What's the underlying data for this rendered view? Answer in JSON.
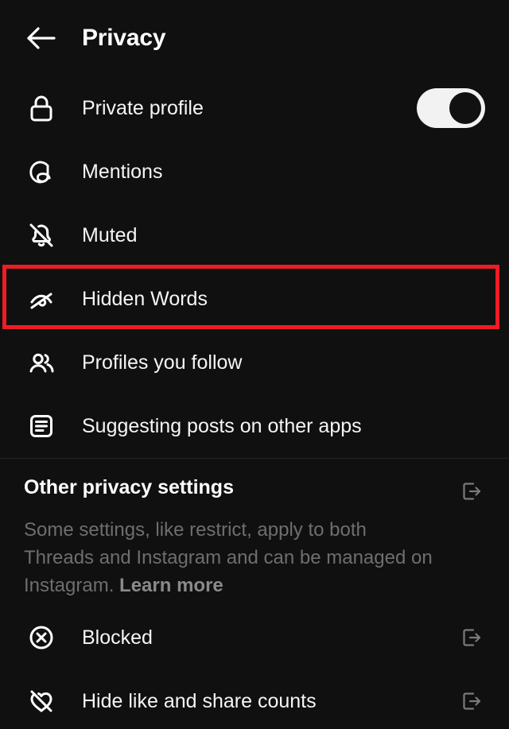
{
  "header": {
    "title": "Privacy",
    "back_icon": "arrow-left-icon"
  },
  "main_settings": [
    {
      "label": "Private profile",
      "icon": "lock-icon",
      "control": "toggle",
      "toggle_on": true
    },
    {
      "label": "Mentions",
      "icon": "threads-logo-icon",
      "control": "none"
    },
    {
      "label": "Muted",
      "icon": "bell-slash-icon",
      "control": "none"
    },
    {
      "label": "Hidden Words",
      "icon": "eye-slash-icon",
      "control": "none",
      "highlighted": true
    },
    {
      "label": "Profiles you follow",
      "icon": "people-icon",
      "control": "none"
    },
    {
      "label": "Suggesting posts on other apps",
      "icon": "list-card-icon",
      "control": "none"
    }
  ],
  "other_section": {
    "title": "Other privacy settings",
    "description_prefix": "Some settings, like restrict, apply to both Threads and Instagram and can be managed on Instagram. ",
    "learn_more_label": "Learn more",
    "external_icon": "external-link-icon",
    "items": [
      {
        "label": "Blocked",
        "icon": "circle-x-icon",
        "external_icon": "external-link-icon"
      },
      {
        "label": "Hide like and share counts",
        "icon": "heart-slash-icon",
        "external_icon": "external-link-icon"
      }
    ]
  },
  "colors": {
    "background": "#101010",
    "text_primary": "#f5f5f5",
    "text_secondary": "#6e6e6e",
    "text_tertiary": "#8a8a8a",
    "highlight": "#ee1c24",
    "toggle_track": "#f2f2f2",
    "divider": "#252525"
  }
}
